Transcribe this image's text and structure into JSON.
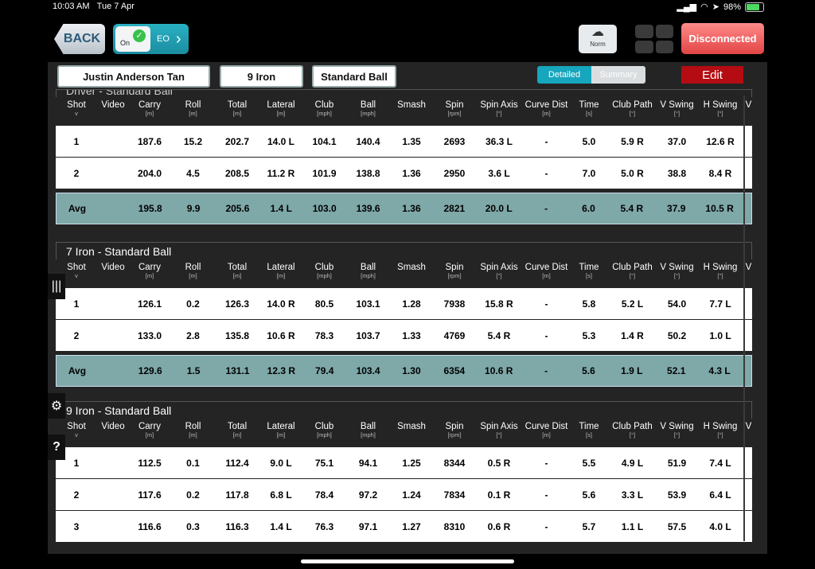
{
  "status": {
    "time": "10:03 AM",
    "date": "Tue 7 Apr",
    "battery": "98%"
  },
  "top": {
    "back": "BACK",
    "eo_on": "On",
    "eo_label": "EO",
    "norm": "Norm",
    "connection": "Disconnected"
  },
  "filters": {
    "player": "Justin Anderson Tan",
    "club": "9 Iron",
    "ball": "Standard Ball"
  },
  "view": {
    "detailed": "Detailed",
    "summary": "Summary",
    "edit": "Edit"
  },
  "columns": [
    {
      "label": "Shot",
      "unit": "v"
    },
    {
      "label": "Video",
      "unit": ""
    },
    {
      "label": "Carry",
      "unit": "[m]"
    },
    {
      "label": "Roll",
      "unit": "[m]"
    },
    {
      "label": "Total",
      "unit": "[m]"
    },
    {
      "label": "Lateral",
      "unit": "[m]"
    },
    {
      "label": "Club",
      "unit": "[mph]"
    },
    {
      "label": "Ball",
      "unit": "[mph]"
    },
    {
      "label": "Smash",
      "unit": ""
    },
    {
      "label": "Spin",
      "unit": "[rpm]"
    },
    {
      "label": "Spin Axis",
      "unit": "[°]"
    },
    {
      "label": "Curve Dist",
      "unit": "[m]"
    },
    {
      "label": "Time",
      "unit": "[s]"
    },
    {
      "label": "Club Path",
      "unit": "[°]"
    },
    {
      "label": "V Swing",
      "unit": "[°]"
    },
    {
      "label": "H Swing",
      "unit": "[°]"
    },
    {
      "label": "V",
      "unit": ""
    }
  ],
  "groups": [
    {
      "title": "Driver - Standard Ball",
      "rows": [
        [
          "1",
          "",
          "187.6",
          "15.2",
          "202.7",
          "14.0 L",
          "104.1",
          "140.4",
          "1.35",
          "2693",
          "36.3 L",
          "-",
          "5.0",
          "5.9 R",
          "37.0",
          "12.6 R",
          ""
        ],
        [
          "2",
          "",
          "204.0",
          "4.5",
          "208.5",
          "11.2 R",
          "101.9",
          "138.8",
          "1.36",
          "2950",
          "3.6 L",
          "-",
          "7.0",
          "5.0 R",
          "38.8",
          "8.4 R",
          ""
        ]
      ],
      "avg": [
        "Avg",
        "",
        "195.8",
        "9.9",
        "205.6",
        "1.4 L",
        "103.0",
        "139.6",
        "1.36",
        "2821",
        "20.0 L",
        "-",
        "6.0",
        "5.4 R",
        "37.9",
        "10.5 R",
        ""
      ]
    },
    {
      "title": "7 Iron - Standard Ball",
      "rows": [
        [
          "1",
          "",
          "126.1",
          "0.2",
          "126.3",
          "14.0 R",
          "80.5",
          "103.1",
          "1.28",
          "7938",
          "15.8 R",
          "-",
          "5.8",
          "5.2 L",
          "54.0",
          "7.7 L",
          ""
        ],
        [
          "2",
          "",
          "133.0",
          "2.8",
          "135.8",
          "10.6 R",
          "78.3",
          "103.7",
          "1.33",
          "4769",
          "5.4 R",
          "-",
          "5.3",
          "1.4 R",
          "50.2",
          "1.0 L",
          ""
        ]
      ],
      "avg": [
        "Avg",
        "",
        "129.6",
        "1.5",
        "131.1",
        "12.3 R",
        "79.4",
        "103.4",
        "1.30",
        "6354",
        "10.6 R",
        "-",
        "5.6",
        "1.9 L",
        "52.1",
        "4.3 L",
        ""
      ]
    },
    {
      "title": "9 Iron - Standard Ball",
      "rows": [
        [
          "1",
          "",
          "112.5",
          "0.1",
          "112.4",
          "9.0 L",
          "75.1",
          "94.1",
          "1.25",
          "8344",
          "0.5 R",
          "-",
          "5.5",
          "4.9 L",
          "51.9",
          "7.4 L",
          ""
        ],
        [
          "2",
          "",
          "117.6",
          "0.2",
          "117.8",
          "6.8 L",
          "78.4",
          "97.2",
          "1.24",
          "7834",
          "0.1 R",
          "-",
          "5.6",
          "3.3 L",
          "53.9",
          "6.4 L",
          ""
        ],
        [
          "3",
          "",
          "116.6",
          "0.3",
          "116.3",
          "1.4 L",
          "76.3",
          "97.1",
          "1.27",
          "8310",
          "0.6 R",
          "-",
          "5.7",
          "1.1 L",
          "57.5",
          "4.0 L",
          ""
        ]
      ],
      "avg": null
    }
  ]
}
